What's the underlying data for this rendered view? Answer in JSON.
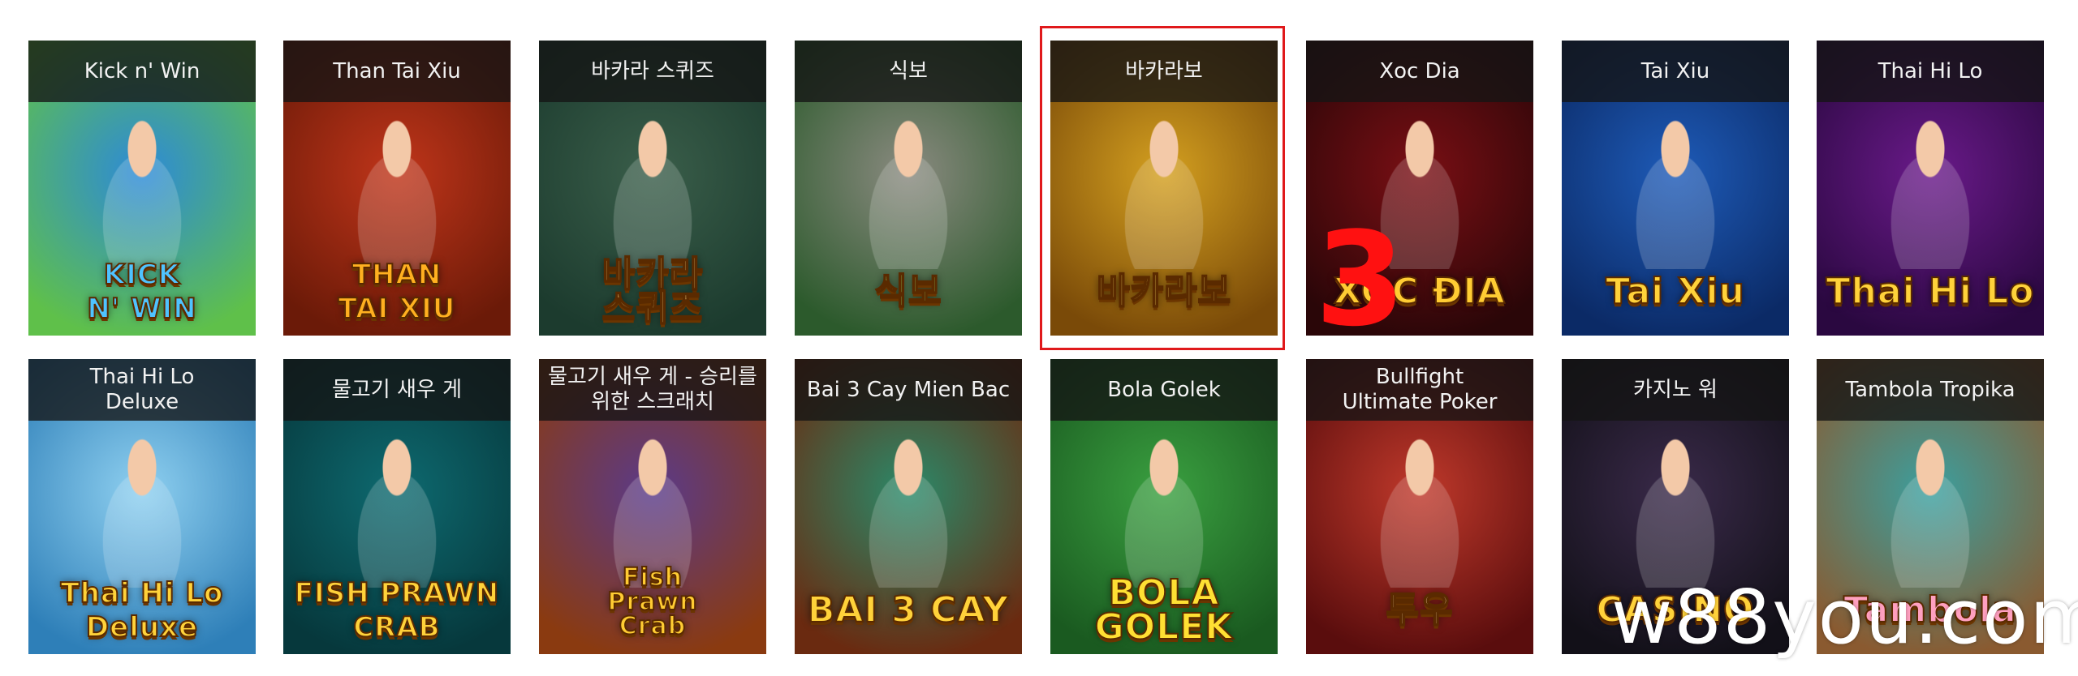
{
  "overlay": {
    "badge_number": "3",
    "watermark": "w88you.com",
    "highlight_color": "#e0191b"
  },
  "games": [
    {
      "title": "Kick n' Win",
      "logo": "KICK\nN' WIN",
      "bg": "#2d8ad8",
      "bg2": "#5fc04a",
      "logo_color": "#4fc3ff"
    },
    {
      "title": "Than Tai Xiu",
      "logo": "THAN\nTAI XIU",
      "bg": "#c0351a",
      "bg2": "#6b1a08",
      "logo_color": "#ffb020"
    },
    {
      "title": "바카라 스퀴즈",
      "logo": "바카라\n스퀴즈",
      "bg": "#3a5e4a",
      "bg2": "#1c3b2e",
      "logo_color": "#ffe08a"
    },
    {
      "title": "식보",
      "logo": "식보",
      "bg": "#8a8a80",
      "bg2": "#2c5a2c",
      "logo_color": "#9be36b"
    },
    {
      "title": "바카라보",
      "logo": "바카라보",
      "bg": "#d4a020",
      "bg2": "#7a4a08",
      "logo_color": "#ffe066"
    },
    {
      "title": "Xoc Dia",
      "logo": "XOC ĐIA",
      "bg": "#7a0f14",
      "bg2": "#2a0608",
      "logo_color": "#ffcc33"
    },
    {
      "title": "Tai Xiu",
      "logo": "Tai Xiu",
      "bg": "#1e5bb8",
      "bg2": "#0b2a66",
      "logo_color": "#ffd23a"
    },
    {
      "title": "Thai Hi Lo",
      "logo": "Thai Hi Lo",
      "bg": "#6a1a8a",
      "bg2": "#2a0840",
      "logo_color": "#ffd23a"
    },
    {
      "title": "Thai Hi Lo\nDeluxe",
      "logo": "Thai Hi Lo\nDeluxe",
      "bg": "#8fd0f0",
      "bg2": "#2e7fb8",
      "logo_color": "#ffd23a"
    },
    {
      "title": "물고기 새우 게",
      "logo": "FISH PRAWN CRAB",
      "bg": "#0e6a70",
      "bg2": "#06383c",
      "logo_color": "#ffd23a"
    },
    {
      "title": "물고기 새우 게 - 승리를\n위한 스크래치",
      "logo": "Fish\nPrawn\nCrab",
      "bg": "#5a3a8a",
      "bg2": "#8a3a10",
      "logo_color": "#ffcc33"
    },
    {
      "title": "Bai 3 Cay Mien Bac",
      "logo": "BAI 3 CAY",
      "bg": "#2a8a6a",
      "bg2": "#6a2a10",
      "logo_color": "#ffd23a"
    },
    {
      "title": "Bola Golek",
      "logo": "BOLA\nGOLEK",
      "bg": "#3aa040",
      "bg2": "#1a5a20",
      "logo_color": "#ffe033"
    },
    {
      "title": "Bullfight\nUltimate Poker",
      "logo": "투우",
      "bg": "#c0392b",
      "bg2": "#5a0d0d",
      "logo_color": "#ffe6b0"
    },
    {
      "title": "카지노 워",
      "logo": "CASINO",
      "bg": "#3a2a4a",
      "bg2": "#121018",
      "logo_color": "#ffd23a"
    },
    {
      "title": "Tambola Tropika",
      "logo": "Tambola",
      "bg": "#3aa0a0",
      "bg2": "#8a5a30",
      "logo_color": "#ffa0c0"
    }
  ]
}
